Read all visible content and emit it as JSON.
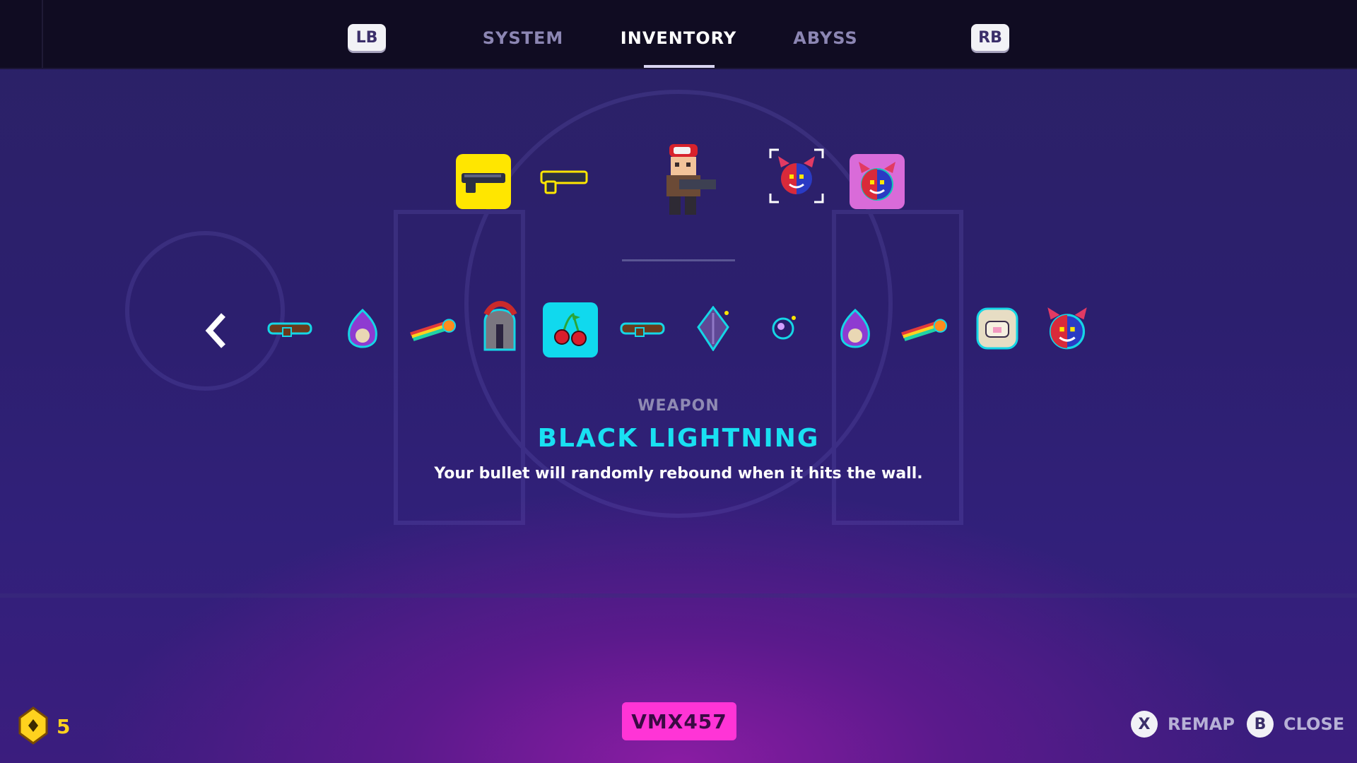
{
  "nav": {
    "left_bumper": "LB",
    "right_bumper": "RB",
    "tabs": [
      {
        "label": "SYSTEM"
      },
      {
        "label": "INVENTORY"
      },
      {
        "label": "ABYSS"
      }
    ],
    "active_tab": "INVENTORY"
  },
  "loadout": {
    "slots": [
      {
        "icon": "pistol-icon",
        "style": "selected-yellow"
      },
      {
        "icon": "pistol-icon",
        "style": "outlined"
      },
      {
        "icon": "demon-mask-icon",
        "style": "bracket-selected"
      },
      {
        "icon": "demon-mask-icon",
        "style": "pink"
      }
    ],
    "character": "gunner-character"
  },
  "items": [
    {
      "icon": "wooden-club-icon"
    },
    {
      "icon": "skull-flame-icon"
    },
    {
      "icon": "rainbow-comet-icon"
    },
    {
      "icon": "spartan-helmet-icon"
    },
    {
      "icon": "cherries-icon",
      "selected": true
    },
    {
      "icon": "wooden-club-icon"
    },
    {
      "icon": "purple-crystal-icon"
    },
    {
      "icon": "orb-icon"
    },
    {
      "icon": "skull-flame-icon"
    },
    {
      "icon": "rainbow-comet-icon"
    },
    {
      "icon": "pig-badge-icon"
    },
    {
      "icon": "demon-mask-icon"
    }
  ],
  "detail": {
    "category": "WEAPON",
    "name": "BLACK LIGHTNING",
    "description": "Your bullet will randomly rebound when it hits the wall."
  },
  "footer": {
    "currency": "5",
    "code": "VMX457",
    "hints": [
      {
        "button": "X",
        "label": "REMAP"
      },
      {
        "button": "B",
        "label": "CLOSE"
      }
    ]
  },
  "colors": {
    "accent_cyan": "#10d9ee",
    "accent_yellow": "#ffe600",
    "accent_pink": "#ff34d6",
    "currency": "#ffd21e"
  }
}
